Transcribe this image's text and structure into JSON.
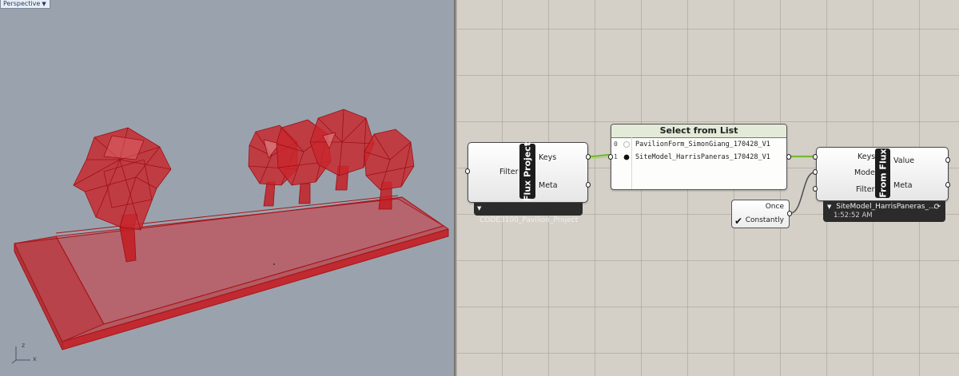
{
  "viewport": {
    "tab_label": "Perspective",
    "axes": {
      "x": "x",
      "y": "y",
      "z": "z"
    }
  },
  "components": {
    "flux_project": {
      "title": "Flux Project",
      "input": "Filter",
      "outputs": [
        "Keys",
        "Meta"
      ],
      "badge": "CODE3100_Pavilion_Project"
    },
    "select_from_list": {
      "title": "Select from List",
      "items": [
        {
          "index": "0",
          "label": "PavilionForm_SimonGiang_170428_V1",
          "selected": false
        },
        {
          "index": "1",
          "label": "SiteModel_HarrisPaneras_170428_V1",
          "selected": true
        }
      ]
    },
    "trigger": {
      "options": [
        "Once",
        "Constantly"
      ],
      "checked": "Constantly"
    },
    "from_flux": {
      "title": "From Flux",
      "inputs": [
        "Keys",
        "Mode",
        "Filter"
      ],
      "outputs": [
        "Value",
        "Meta"
      ],
      "badge": "SiteModel_HarrisPaneras_...",
      "time": "1:52:52 AM"
    }
  },
  "colors": {
    "viewport_bg": "#9aa3ad",
    "canvas_bg": "#d4d0c8",
    "geometry_red": "#c4161c",
    "wire_green": "#77b82e"
  },
  "icons": [
    "dropdown-caret-icon",
    "refresh-icon",
    "checkmark-icon",
    "axis-gizmo-icon"
  ]
}
